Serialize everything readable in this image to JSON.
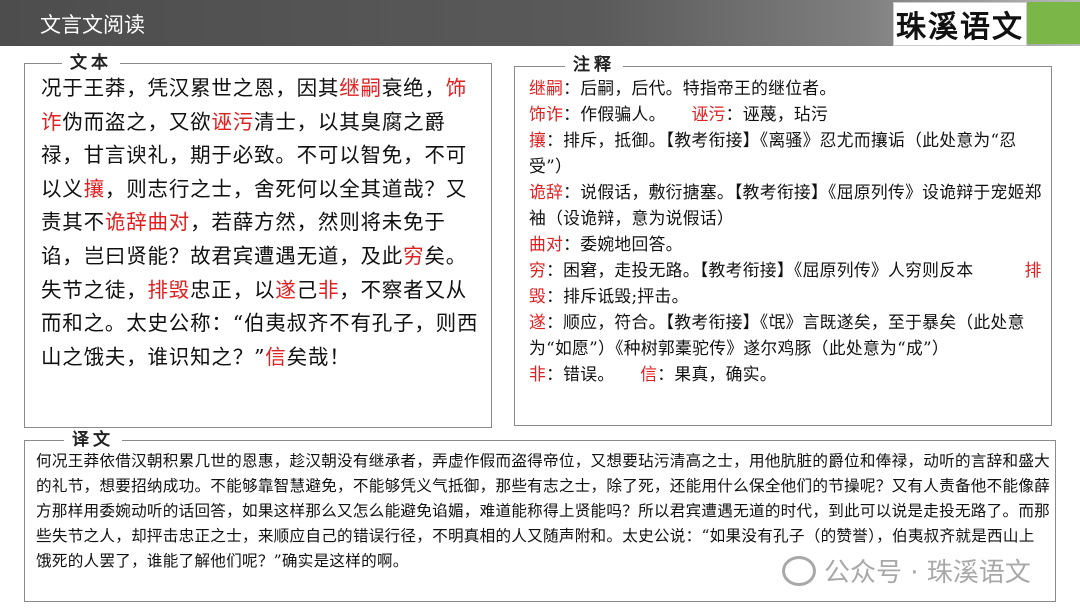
{
  "header": {
    "title": "文言文阅读",
    "logo": "珠溪语文"
  },
  "text_section": {
    "label": "文本",
    "segments": [
      {
        "t": "况于王莽，凭汉累世之恩，因其",
        "red": false
      },
      {
        "t": "继嗣",
        "red": true
      },
      {
        "t": "衰绝，",
        "red": false
      },
      {
        "t": "饰诈",
        "red": true
      },
      {
        "t": "伪而盗之，又欲",
        "red": false
      },
      {
        "t": "诬污",
        "red": true
      },
      {
        "t": "清士，以其臭腐之爵禄，甘言谀礼，期于必致。不可以智免，不可以义",
        "red": false
      },
      {
        "t": "攘",
        "red": true
      },
      {
        "t": "，则志行之士，舍死何以全其道哉？又责其不",
        "red": false
      },
      {
        "t": "诡辞曲对",
        "red": true
      },
      {
        "t": "，若薛方然，然则将未免于谄，岂曰贤能？故君宾遭遇无道，及此",
        "red": false
      },
      {
        "t": "穷",
        "red": true
      },
      {
        "t": "矣。失节之徒，",
        "red": false
      },
      {
        "t": "排毁",
        "red": true
      },
      {
        "t": "忠正，以",
        "red": false
      },
      {
        "t": "遂",
        "red": true
      },
      {
        "t": "己",
        "red": false
      },
      {
        "t": "非",
        "red": true
      },
      {
        "t": "，不察者又从而和之。太史公称：“伯夷叔齐不有孔子，则西山之饿夫，谁识知之？”",
        "red": false
      },
      {
        "t": "信",
        "red": true
      },
      {
        "t": "矣哉！",
        "red": false
      }
    ]
  },
  "notes_section": {
    "label": "注释",
    "lines": [
      [
        {
          "t": "继嗣",
          "red": true
        },
        {
          "t": "：后嗣，后代。特指帝王的继位者。",
          "red": false
        }
      ],
      [
        {
          "t": "饰诈",
          "red": true
        },
        {
          "t": "：作假骗人。　　",
          "red": false
        },
        {
          "t": "诬污",
          "red": true
        },
        {
          "t": "：诬蔑，玷污",
          "red": false
        }
      ],
      [
        {
          "t": "攘",
          "red": true
        },
        {
          "t": "：排斥，抵御。【教考衔接】《离骚》忍尤而攘诟（此处意为“忍受”）",
          "red": false
        }
      ],
      [
        {
          "t": "诡辞",
          "red": true
        },
        {
          "t": "：说假话，敷衍搪塞。【教考衔接】《屈原列传》设诡辩于宠姬郑袖（设诡辩，意为说假话）",
          "red": false
        }
      ],
      [
        {
          "t": "曲对",
          "red": true
        },
        {
          "t": "：委婉地回答。",
          "red": false
        }
      ],
      [
        {
          "t": "穷",
          "red": true
        },
        {
          "t": "：困窘，走投无路。【教考衔接】《屈原列传》人穷则反本　　　",
          "red": false
        },
        {
          "t": "排毁",
          "red": true
        },
        {
          "t": "：排斥诋毁;抨击。",
          "red": false
        }
      ],
      [
        {
          "t": "遂",
          "red": true
        },
        {
          "t": "：顺应，符合。【教考衔接】《氓》言既遂矣，至于暴矣（此处意为“如愿”）《种树郭橐驼传》遂尔鸡豚（此处意为“成”）",
          "red": false
        }
      ],
      [
        {
          "t": "非",
          "red": true
        },
        {
          "t": "：错误。　　",
          "red": false
        },
        {
          "t": "信",
          "red": true
        },
        {
          "t": "：果真，确实。",
          "red": false
        }
      ]
    ]
  },
  "translation_section": {
    "label": "译文",
    "text": "何况王莽依借汉朝积累几世的恩惠，趁汉朝没有继承者，弄虚作假而盗得帝位，又想要玷污清高之士，用他肮脏的爵位和俸禄，动听的言辞和盛大的礼节，想要招纳成功。不能够靠智慧避免，不能够凭义气抵御，那些有志之士，除了死，还能用什么保全他们的节操呢？又有人责备他不能像薛方那样用委婉动听的话回答，如果这样那么又怎么能避免谄媚，难道能称得上贤能吗？所以君宾遭遇无道的时代，到此可以说是走投无路了。而那些失节之人，却抨击忠正之士，来顺应自己的错误行径，不明真相的人又随声附和。太史公说：“如果没有孔子（的赞誉），伯夷叔齐就是西山上饿死的人罢了，谁能了解他们呢？”确实是这样的啊。"
  },
  "watermark": "公众号 · 珠溪语文"
}
